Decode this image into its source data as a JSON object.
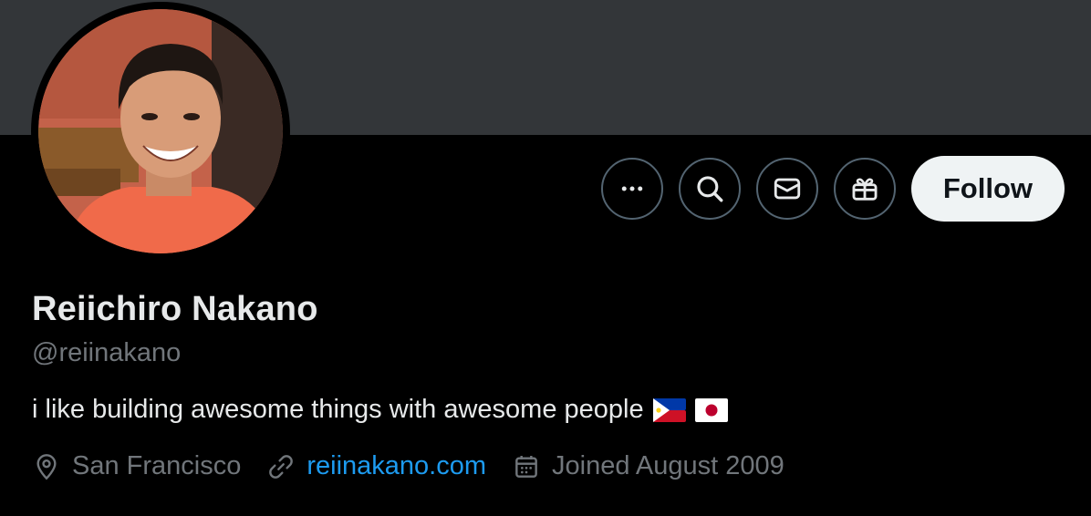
{
  "profile": {
    "name": "Reiichiro Nakano",
    "handle": "@reiinakano",
    "bio": "i like building awesome things with awesome people",
    "bio_flags": [
      "philippines-flag",
      "japan-flag"
    ],
    "location": "San Francisco",
    "website": "reiinakano.com",
    "joined": "Joined August 2009"
  },
  "actions": {
    "follow_label": "Follow",
    "icons": [
      "more-icon",
      "search-icon",
      "message-icon",
      "gift-icon"
    ]
  },
  "colors": {
    "background": "#000000",
    "banner": "#333639",
    "primary_text": "#e7e9ea",
    "secondary_text": "#71767b",
    "link": "#1d9bf0",
    "icon_border": "#536471",
    "follow_bg": "#eff3f4"
  }
}
